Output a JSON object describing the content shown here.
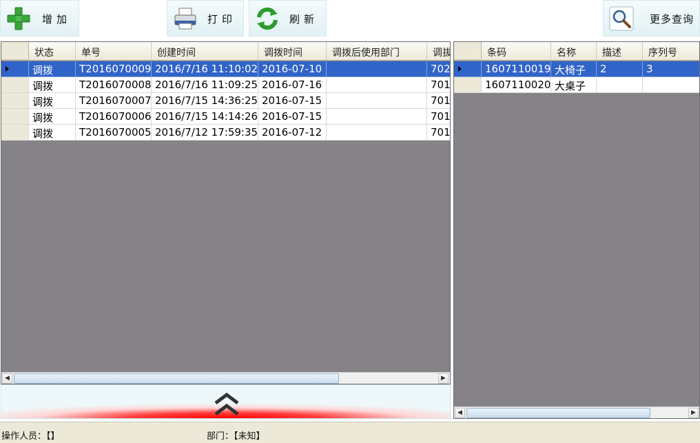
{
  "toolbar": {
    "add": "增加",
    "print": "打印",
    "refresh": "刷新",
    "more_query": "更多查询"
  },
  "left_grid": {
    "columns": [
      "状态",
      "单号",
      "创建时间",
      "调拨时间",
      "调拨后使用部门",
      "调拔"
    ],
    "rows": [
      {
        "status": "调拨",
        "number": "T2016070009",
        "created": "2016/7/16 11:10:02",
        "transfer_date": "2016-07-10",
        "dept": "",
        "extra": "702",
        "selected": true
      },
      {
        "status": "调拨",
        "number": "T2016070008",
        "created": "2016/7/16 11:09:25",
        "transfer_date": "2016-07-16",
        "dept": "",
        "extra": "701",
        "selected": false
      },
      {
        "status": "调拨",
        "number": "T2016070007",
        "created": "2016/7/15 14:36:25",
        "transfer_date": "2016-07-15",
        "dept": "",
        "extra": "701",
        "selected": false
      },
      {
        "status": "调拨",
        "number": "T2016070006",
        "created": "2016/7/15 14:14:26",
        "transfer_date": "2016-07-15",
        "dept": "",
        "extra": "701",
        "selected": false
      },
      {
        "status": "调拨",
        "number": "T2016070005",
        "created": "2016/7/12 17:59:35",
        "transfer_date": "2016-07-12",
        "dept": "",
        "extra": "701",
        "selected": false
      }
    ]
  },
  "right_grid": {
    "columns": [
      "条码",
      "名称",
      "描述",
      "序列号"
    ],
    "rows": [
      {
        "barcode": "1607110019",
        "name": "大椅子",
        "desc": "2",
        "serial": "3",
        "selected": true
      },
      {
        "barcode": "1607110020",
        "name": "大桌子",
        "desc": "",
        "serial": "",
        "selected": false
      }
    ]
  },
  "status_bar": {
    "operator": "操作人员：【】",
    "department": "部门：【未知】"
  },
  "icons": {
    "add": "plus-icon",
    "print": "printer-icon",
    "refresh": "refresh-icon",
    "more_query": "magnifier-icon",
    "splitter": "double-chevron-up-icon"
  },
  "colors": {
    "selection": "#3164c8",
    "grid_background": "#858387",
    "add_icon": "#3aa53a",
    "refresh_icon": "#2e9b2e"
  }
}
